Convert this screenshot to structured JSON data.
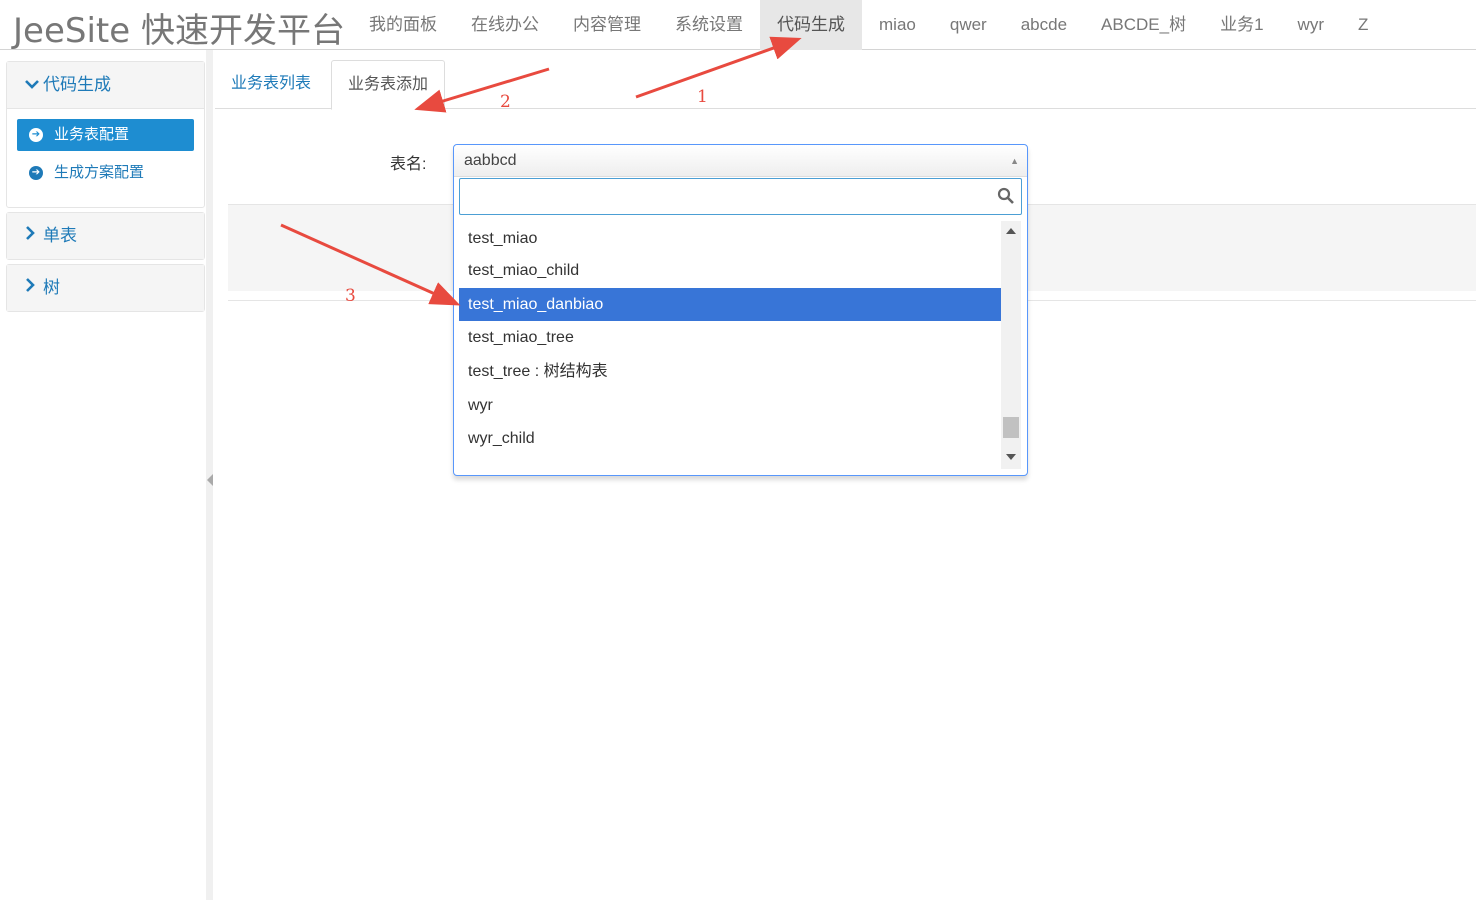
{
  "brand": "JeeSite 快速开发平台",
  "nav": [
    "我的面板",
    "在线办公",
    "内容管理",
    "系统设置",
    "代码生成",
    "miao",
    "qwer",
    "abcde",
    "ABCDE_树",
    "业务1",
    "wyr",
    "Z"
  ],
  "nav_active_index": 4,
  "sidebar": {
    "groups": [
      {
        "title": "代码生成",
        "expanded": true,
        "items": [
          {
            "label": "业务表配置",
            "active": true
          },
          {
            "label": "生成方案配置",
            "active": false
          }
        ]
      },
      {
        "title": "单表",
        "expanded": false
      },
      {
        "title": "树",
        "expanded": false
      }
    ]
  },
  "tabs": [
    {
      "label": "业务表列表",
      "active": false
    },
    {
      "label": "业务表添加",
      "active": true
    }
  ],
  "form": {
    "table_label": "表名:",
    "select_value": "aabbcd",
    "search_placeholder": "",
    "options": [
      "test_miao",
      "test_miao_child",
      "test_miao_danbiao",
      "test_miao_tree",
      "test_tree : 树结构表",
      "wyr",
      "wyr_child"
    ],
    "highlighted_option": "test_miao_danbiao"
  },
  "annotations": {
    "labels": [
      "1",
      "2",
      "3"
    ],
    "color": "#e84a3f"
  },
  "colors": {
    "link_blue": "#1e7ab8",
    "active_sidebar": "#1e8dd1",
    "highlight": "#3875d7"
  }
}
